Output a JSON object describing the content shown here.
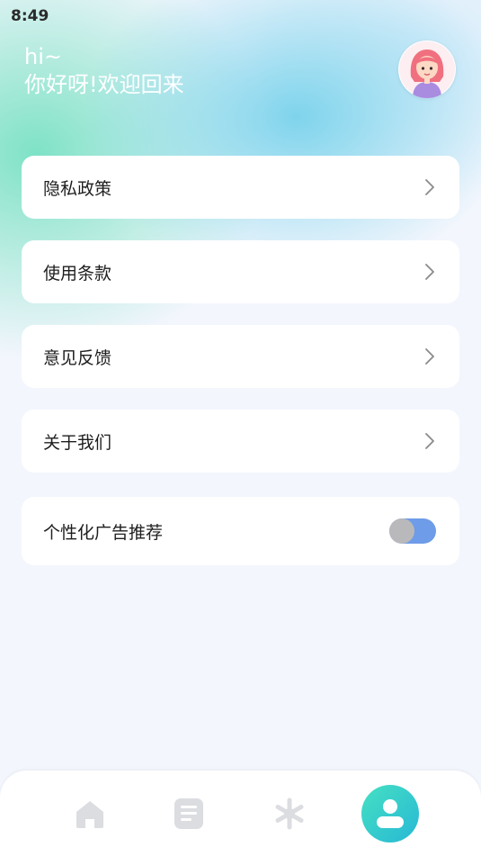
{
  "status_bar": {
    "time": "8:49"
  },
  "header": {
    "hi": "hi~",
    "welcome": "你好呀!欢迎回来"
  },
  "avatar_icon": "girl-avatar-icon",
  "menu": {
    "items": [
      {
        "label": "隐私政策",
        "icon": "chevron-right-icon"
      },
      {
        "label": "使用条款",
        "icon": "chevron-right-icon"
      },
      {
        "label": "意见反馈",
        "icon": "chevron-right-icon"
      },
      {
        "label": "关于我们",
        "icon": "chevron-right-icon"
      }
    ],
    "ad_toggle": {
      "label": "个性化广告推荐",
      "enabled": false
    }
  },
  "tabbar": {
    "tabs": [
      {
        "icon": "home-icon",
        "active": false
      },
      {
        "icon": "document-icon",
        "active": false
      },
      {
        "icon": "sparkle-icon",
        "active": false
      },
      {
        "icon": "profile-icon",
        "active": true
      }
    ]
  },
  "colors": {
    "accent": "#27b8d6",
    "toggle_track": "#6e9ce8",
    "tab_inactive": "#dcdde1",
    "background": "#f3f6fd"
  }
}
